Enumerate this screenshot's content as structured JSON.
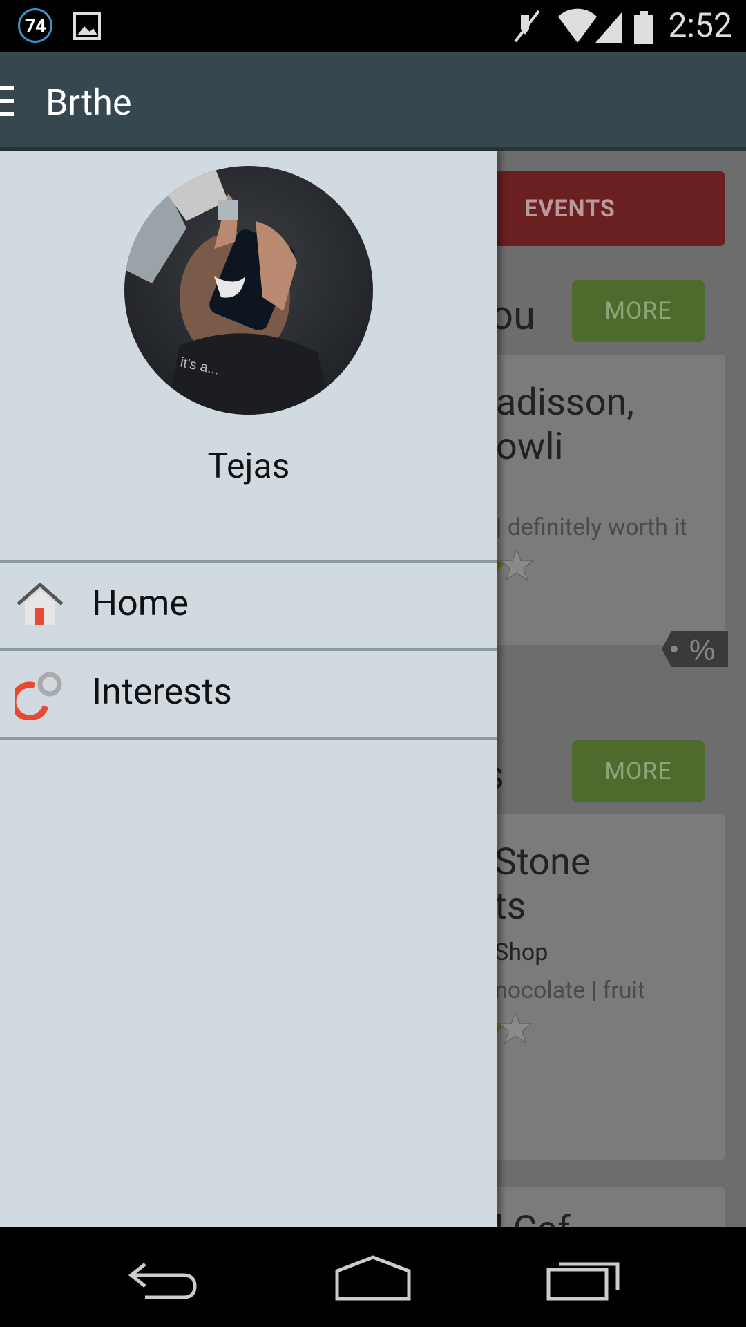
{
  "status_bar": {
    "notification_count": "74",
    "time": "2:52",
    "icons": [
      "gallery-icon",
      "mute-icon",
      "wifi-icon",
      "signal-icon",
      "battery-icon"
    ]
  },
  "app_bar": {
    "title": "Brthe"
  },
  "background": {
    "events_button": "EVENTS",
    "sections": [
      {
        "title_fragment": "ou",
        "more_label": "MORE",
        "card": {
          "name_line1": "adisson,",
          "name_line2": "owli",
          "tags": "| definitely worth it"
        }
      },
      {
        "title_fragment": "s",
        "more_label": "MORE",
        "card": {
          "name_line1": "Stone",
          "name_line2": "ts",
          "category": "Shop",
          "tags": "nocolate | fruit"
        }
      }
    ],
    "bottom_card_fragment": "l  Caf"
  },
  "drawer": {
    "username": "Tejas",
    "items": [
      {
        "label": "Home",
        "icon": "home-icon"
      },
      {
        "label": "Interests",
        "icon": "interests-icon"
      }
    ]
  },
  "colors": {
    "app_bar": "#37474f",
    "drawer_bg": "#d1dae1",
    "accent_red": "#e53935",
    "more_green": "#689f38"
  }
}
